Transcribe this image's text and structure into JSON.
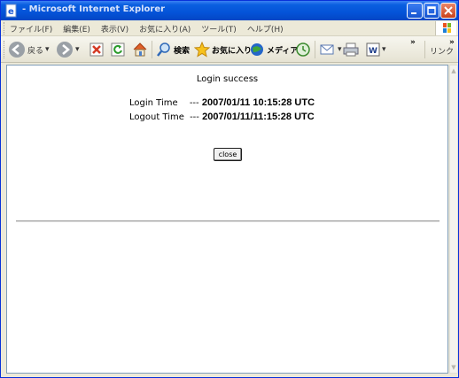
{
  "window": {
    "title": "- Microsoft Internet Explorer"
  },
  "menu": {
    "items": [
      "ファイル(F)",
      "編集(E)",
      "表示(V)",
      "お気に入り(A)",
      "ツール(T)",
      "ヘルプ(H)"
    ]
  },
  "toolbar": {
    "back_label": "戻る",
    "search_label": "検索",
    "favorites_label": "お気に入り",
    "media_label": "メディア",
    "links_label": "リンク",
    "icons": [
      "back-icon",
      "forward-icon",
      "stop-icon",
      "refresh-icon",
      "home-icon",
      "search-icon",
      "favorites-icon",
      "media-icon",
      "history-icon",
      "mail-icon",
      "print-icon",
      "word-icon"
    ]
  },
  "page": {
    "heading": "Login success",
    "login_label": "Login Time",
    "login_sep": "---",
    "login_value": "2007/01/11 10:15:28 UTC",
    "logout_label": "Logout Time",
    "logout_sep": "---",
    "logout_value": "2007/01/11/11:15:28 UTC",
    "close_button": "close"
  },
  "colors": {
    "titlebar": "#0453d8",
    "chrome": "#ece9d8",
    "close_caption": "#c9421b"
  }
}
